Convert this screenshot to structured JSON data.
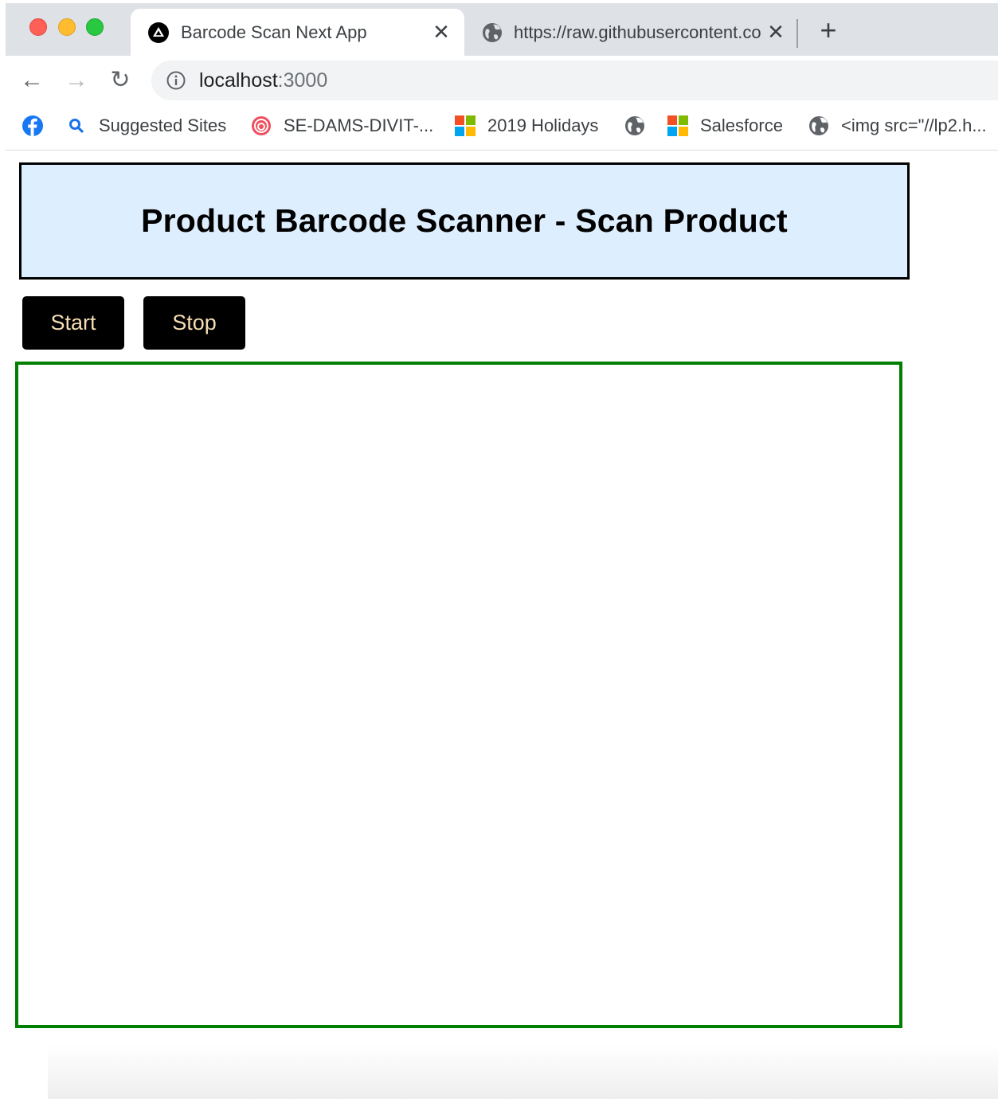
{
  "browser": {
    "tabs": [
      {
        "title": "Barcode Scan Next App",
        "favicon": "nextjs-triangle-icon",
        "active": true
      },
      {
        "title": "https://raw.githubusercontent.com",
        "favicon": "globe-icon",
        "active": false
      }
    ],
    "address_bar": {
      "host": "localhost",
      "port": ":3000",
      "security_icon": "info-icon"
    },
    "bookmarks": [
      {
        "label": "",
        "icon": "facebook-icon"
      },
      {
        "label": "Suggested Sites",
        "icon": "search-icon"
      },
      {
        "label": "SE-DAMS-DIVIT-...",
        "icon": "red-circle-icon"
      },
      {
        "label": "2019 Holidays",
        "icon": "microsoft-icon"
      },
      {
        "label": "",
        "icon": "globe-icon"
      },
      {
        "label": "Salesforce",
        "icon": "microsoft-icon"
      },
      {
        "label": "<img src=\"//lp2.h...",
        "icon": "globe-icon"
      }
    ]
  },
  "page": {
    "title": "Product Barcode Scanner - Scan Product",
    "buttons": {
      "start_label": "Start",
      "stop_label": "Stop"
    }
  },
  "colors": {
    "banner_background": "#ddeefe",
    "button_background": "#000000",
    "button_text": "#f5deb3",
    "scan_area_border": "#008000"
  }
}
